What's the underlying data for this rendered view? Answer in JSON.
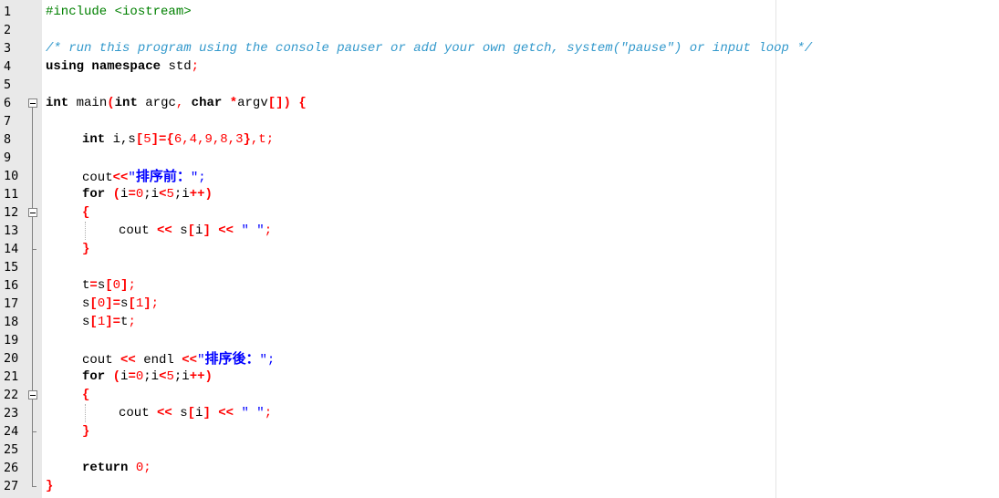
{
  "editor": {
    "colors": {
      "keyword": "#000000",
      "preprocessor": "#008000",
      "comment": "#3399cc",
      "operator": "#ff0000",
      "number": "#ff0000",
      "string": "#0000ff",
      "gutter": "#e9e9e9"
    },
    "line_numbers": [
      "1",
      "2",
      "3",
      "4",
      "5",
      "6",
      "7",
      "8",
      "9",
      "10",
      "11",
      "12",
      "13",
      "14",
      "15",
      "16",
      "17",
      "18",
      "19",
      "20",
      "21",
      "22",
      "23",
      "24",
      "25",
      "26",
      "27"
    ],
    "lines": {
      "l1": {
        "pp": "#include <iostream>"
      },
      "l3": {
        "cm": "/* run this program using the console pauser or add your own getch, system(\"pause\") or input loop */"
      },
      "l4": {
        "kw1": "using",
        "kw2": "namespace",
        "rest": " std",
        "semi": ";"
      },
      "l6": {
        "kw1": "int",
        "name": " main",
        "p1": "(",
        "kw2": "int",
        "a1": " argc",
        "comma": ",",
        "kw3": " char",
        "star": " *",
        "a2": "argv",
        "br": "[])",
        "brace": " {"
      },
      "l8": {
        "kw": "int",
        "a": " i,s",
        "b1": "[",
        "n5": "5",
        "b2": "]={",
        "vals": "6,4,9,8,3",
        "b3": "}",
        "rest": ",t;"
      },
      "l10": {
        "id": "cout",
        "op": "<<",
        "q1": "\"",
        "cjk": "排序前：",
        "q2": "\";"
      },
      "l11": {
        "kw": "for",
        "p": " (",
        "a": "i",
        "eq": "=",
        "n0": "0",
        "s1": ";i",
        "lt": "<",
        "n5": "5",
        "s2": ";i",
        "pp": "++)"
      },
      "l12": {
        "brace": "{"
      },
      "l13": {
        "id": "cout",
        "op1": " <<",
        "s": " s",
        "b1": "[",
        "i": "i",
        "b2": "]",
        "op2": " <<",
        "str": " \" \"",
        "semi": ";"
      },
      "l14": {
        "brace": "}"
      },
      "l16": {
        "t": "t",
        "eq": "=",
        "s": "s",
        "b1": "[",
        "n": "0",
        "b2": "]",
        "semi": ";"
      },
      "l17": {
        "s": "s",
        "b1": "[",
        "n1": "0",
        "b2": "]=",
        "s2": "s",
        "b3": "[",
        "n2": "1",
        "b4": "]",
        "semi": ";"
      },
      "l18": {
        "s": "s",
        "b1": "[",
        "n": "1",
        "b2": "]=",
        "t": "t",
        "semi": ";"
      },
      "l20": {
        "id": "cout",
        "op1": " <<",
        "endl": " endl",
        "op2": " <<",
        "q1": "\"",
        "cjk": "排序後：",
        "q2": "\";"
      },
      "l21": {
        "kw": "for",
        "p": " (",
        "a": "i",
        "eq": "=",
        "n0": "0",
        "s1": ";i",
        "lt": "<",
        "n5": "5",
        "s2": ";i",
        "pp": "++)"
      },
      "l22": {
        "brace": "{"
      },
      "l23": {
        "id": "cout",
        "op1": " <<",
        "s": " s",
        "b1": "[",
        "i": "i",
        "b2": "]",
        "op2": " <<",
        "str": " \" \"",
        "semi": ";"
      },
      "l24": {
        "brace": "}"
      },
      "l26": {
        "kw": "return",
        "n": " 0",
        "semi": ";"
      },
      "l27": {
        "brace": "}"
      }
    }
  }
}
